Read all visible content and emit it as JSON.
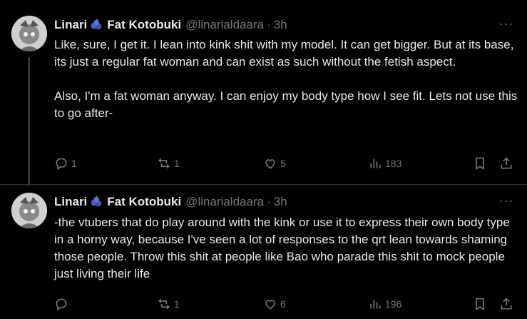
{
  "tweets": [
    {
      "display_name": "Linari",
      "emoji": "blueberries",
      "display_name_2": "Fat Kotobuki",
      "handle": "@linarialdaara",
      "separator": "·",
      "time": "3h",
      "paragraphs": [
        "Like, sure, I get it. I lean into kink shit with my model. It can get bigger. But at its base, its just a regular fat woman and can exist as such without the fetish aspect.",
        "Also, I'm a fat woman anyway. I can enjoy my body type how I see fit. Lets not use this to go after-"
      ],
      "replies": "1",
      "reposts": "1",
      "likes": "5",
      "views": "183"
    },
    {
      "display_name": "Linari",
      "emoji": "blueberries",
      "display_name_2": "Fat Kotobuki",
      "handle": "@linarialdaara",
      "separator": "·",
      "time": "3h",
      "paragraphs": [
        "-the vtubers that do play around with the kink or use it to express their own body type in a horny way, because I've seen a lot of responses to the qrt lean towards shaming those people. Throw this shit at people like Bao who parade this shit to mock people just living their life"
      ],
      "replies": "",
      "reposts": "1",
      "likes": "6",
      "views": "196"
    }
  ],
  "more_label": "···",
  "colors": {
    "background": "#000000",
    "text": "#e7e9ea",
    "muted": "#71767b",
    "divider": "#2f3336"
  },
  "icons": [
    "reply-icon",
    "repost-icon",
    "like-icon",
    "views-icon",
    "bookmark-icon",
    "share-icon",
    "more-icon",
    "blueberry-emoji-icon"
  ]
}
